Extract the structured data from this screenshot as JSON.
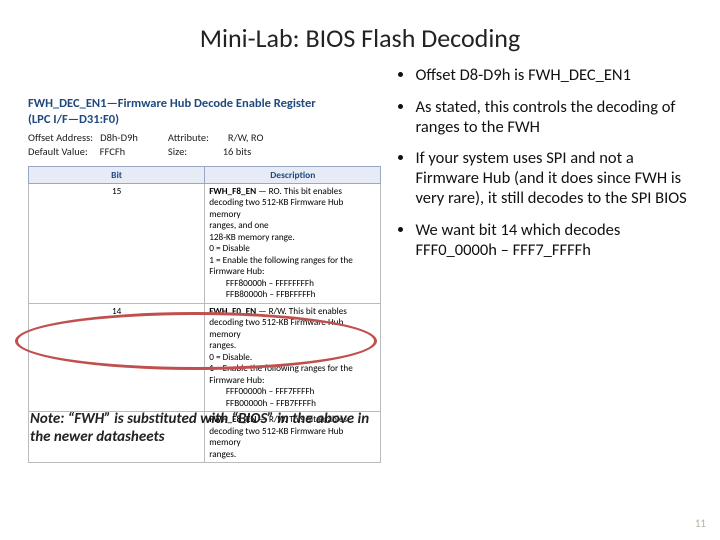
{
  "title": "Mini-Lab: BIOS Flash Decoding",
  "register": {
    "heading": "FWH_DEC_EN1—Firmware Hub Decode Enable Register\n(LPC I/F—D31:F0)",
    "meta_left_1": "Offset Address:   D8h-D9h",
    "meta_left_2": "Default Value:     FFCFh",
    "meta_right_1": "Attribute:        R/W, RO",
    "meta_right_2": "Size:               16 bits",
    "col_bit": "Bit",
    "col_desc": "Description",
    "rows": [
      {
        "bit": "15",
        "name": "FWH_F8_EN",
        "rw": "RO.",
        "body1": "This bit enables decoding two 512-KB Firmware Hub memory",
        "body2": "ranges, and one",
        "body3": "128-KB memory range.",
        "z": "0 = Disable",
        "o": "1 = Enable the following ranges for the Firmware Hub:",
        "r1": "        FFF80000h – FFFFFFFFh",
        "r2": "        FFB80000h – FFBFFFFFh"
      },
      {
        "bit": "14",
        "name": "FWH_F0_EN",
        "rw": "R/W.",
        "body1": "This bit enables decoding two 512-KB Firmware Hub memory",
        "body2": "ranges.",
        "body3": "",
        "z": "0 = Disable.",
        "o": "1 = Enable the following ranges for the Firmware Hub:",
        "r1": "        FFF00000h – FFF7FFFFh",
        "r2": "        FFB00000h – FFB7FFFFh"
      },
      {
        "bit": "",
        "name": "FWH_E8_EN",
        "rw": "R/W.",
        "body1": "This bit enables decoding two 512-KB Firmware Hub memory",
        "body2": "ranges.",
        "body3": ""
      }
    ]
  },
  "bullets": [
    "Offset D8-D9h is FWH_DEC_EN1",
    "As stated, this controls the decoding of ranges to the FWH",
    "If your system uses SPI and not a Firmware Hub (and it does since FWH is very rare), it still decodes to the SPI BIOS",
    "We want bit 14 which decodes FFF0_0000h – FFF7_FFFFh"
  ],
  "note": "Note: “FWH” is substituted with “BIOS” in the above in the newer datasheets",
  "page": "11"
}
